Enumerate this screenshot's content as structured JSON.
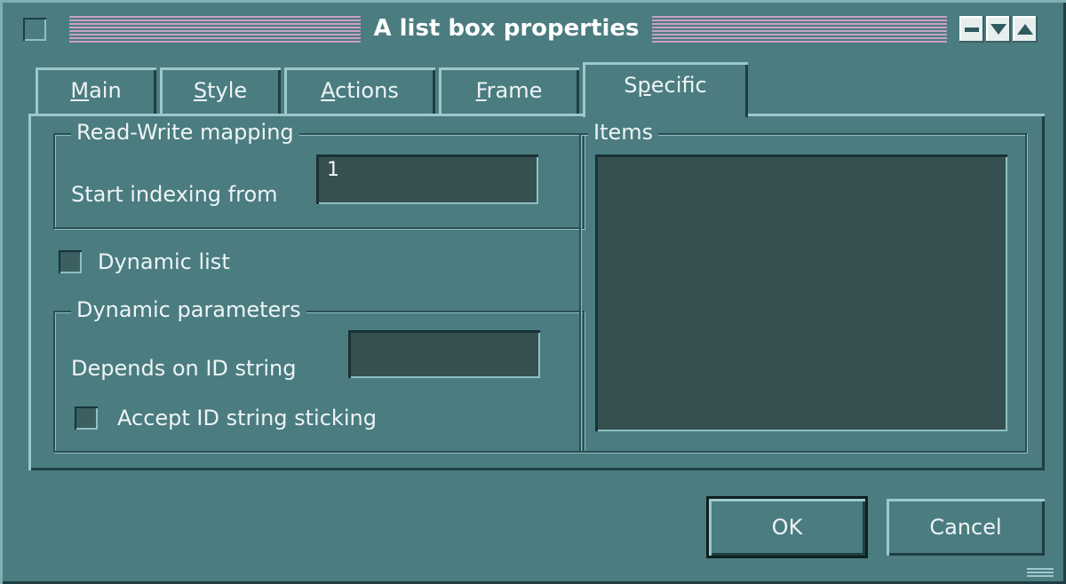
{
  "window": {
    "title": "A list box properties"
  },
  "tabs": [
    {
      "label": "Main",
      "underline": "M",
      "rest": "ain"
    },
    {
      "label": "Style",
      "underline": "S",
      "rest": "tyle"
    },
    {
      "label": "Actions",
      "underline": "A",
      "rest": "ctions"
    },
    {
      "label": "Frame",
      "underline": "F",
      "rest": "rame"
    },
    {
      "label": "Specific",
      "pre": "S",
      "underline": "p",
      "rest": "ecific"
    }
  ],
  "active_tab": "Specific",
  "read_write": {
    "group_label": "Read-Write mapping",
    "start_label": "Start indexing from",
    "start_value": "1"
  },
  "dynamic_list": {
    "label": "Dynamic list",
    "checked": false
  },
  "dynamic_params": {
    "group_label": "Dynamic parameters",
    "depends_label": "Depends on ID string",
    "depends_value": "",
    "sticking_label": "Accept ID string sticking",
    "sticking_checked": false
  },
  "items": {
    "group_label": "Items"
  },
  "buttons": {
    "ok": "OK",
    "cancel": "Cancel"
  },
  "colors": {
    "background": "#4a7c80",
    "field": "#365052",
    "title_stripe": "#c9a0c6"
  }
}
